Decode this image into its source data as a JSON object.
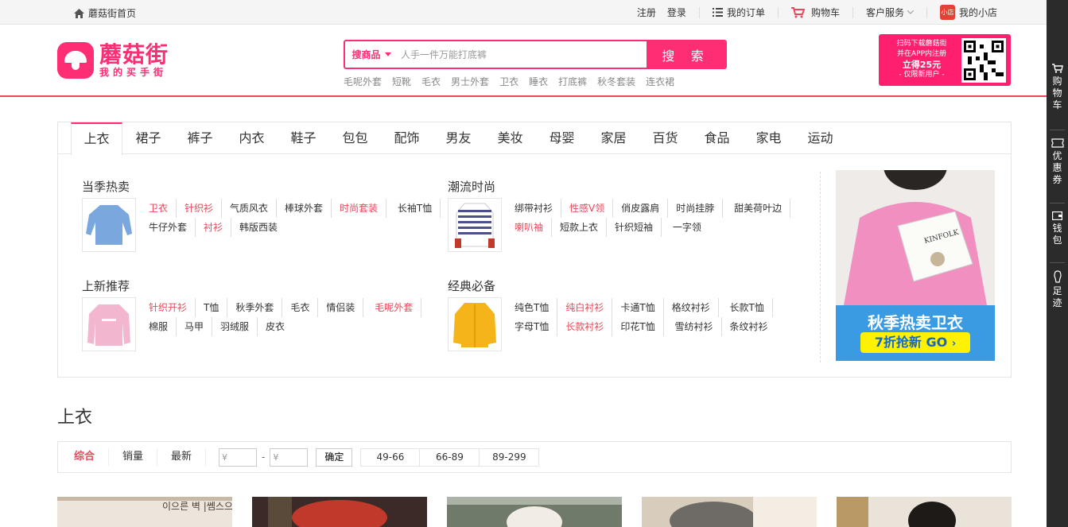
{
  "topbar": {
    "home": "蘑菇街首页",
    "register": "注册",
    "login": "登录",
    "orders": "我的订单",
    "cart": "购物车",
    "service": "客户服务",
    "shop_badge": "小店",
    "shop": "我的小店"
  },
  "logo": {
    "name": "蘑菇街",
    "slogan": "我的买手街"
  },
  "search": {
    "scope": "搜商品",
    "placeholder": "人手一件万能打底裤",
    "button": "搜 索",
    "hotwords": [
      "毛呢外套",
      "短靴",
      "毛衣",
      "男士外套",
      "卫衣",
      "睡衣",
      "打底裤",
      "秋冬套装",
      "连衣裙"
    ]
  },
  "promo": {
    "line1": "扫码下载蘑菇街",
    "line2": "并在APP内注册",
    "line3": "立得25元",
    "line4": "- 仅限新用户 -"
  },
  "sidebar": {
    "cart": "购物车",
    "coupon": "优惠券",
    "wallet": "钱包",
    "footprint": "足迹"
  },
  "tabs": [
    "上衣",
    "裙子",
    "裤子",
    "内衣",
    "鞋子",
    "包包",
    "配饰",
    "男友",
    "美妆",
    "母婴",
    "家居",
    "百货",
    "食品",
    "家电",
    "运动"
  ],
  "groups": [
    {
      "title": "当季热卖",
      "links": [
        {
          "t": "卫衣",
          "hot": true
        },
        {
          "t": "针织衫",
          "hot": true
        },
        {
          "t": "气质风衣",
          "hot": false
        },
        {
          "t": "棒球外套",
          "hot": false
        },
        {
          "t": "时尚套装",
          "hot": true
        },
        {
          "t": "长袖T恤",
          "hot": false
        },
        {
          "t": "牛仔外套",
          "hot": false
        },
        {
          "t": "衬衫",
          "hot": true
        },
        {
          "t": "韩版西装",
          "hot": false
        }
      ]
    },
    {
      "title": "潮流时尚",
      "links": [
        {
          "t": "绑带衬衫",
          "hot": false
        },
        {
          "t": "性感V领",
          "hot": true
        },
        {
          "t": "俏皮露肩",
          "hot": false
        },
        {
          "t": "时尚挂脖",
          "hot": false
        },
        {
          "t": "甜美荷叶边",
          "hot": false
        },
        {
          "t": "喇叭袖",
          "hot": true
        },
        {
          "t": "短款上衣",
          "hot": false
        },
        {
          "t": "针织短袖",
          "hot": false
        },
        {
          "t": "一字领",
          "hot": false
        }
      ]
    },
    {
      "title": "上新推荐",
      "links": [
        {
          "t": "针织开衫",
          "hot": true
        },
        {
          "t": "T恤",
          "hot": false
        },
        {
          "t": "秋季外套",
          "hot": false
        },
        {
          "t": "毛衣",
          "hot": false
        },
        {
          "t": "情侣装",
          "hot": false
        },
        {
          "t": "毛呢外套",
          "hot": true
        },
        {
          "t": "棉服",
          "hot": false
        },
        {
          "t": "马甲",
          "hot": false
        },
        {
          "t": "羽绒服",
          "hot": false
        },
        {
          "t": "皮衣",
          "hot": false
        }
      ]
    },
    {
      "title": "经典必备",
      "links": [
        {
          "t": "纯色T恤",
          "hot": false
        },
        {
          "t": "纯白衬衫",
          "hot": true
        },
        {
          "t": "卡通T恤",
          "hot": false
        },
        {
          "t": "格纹衬衫",
          "hot": false
        },
        {
          "t": "长款T恤",
          "hot": false
        },
        {
          "t": "字母T恤",
          "hot": false
        },
        {
          "t": "长款衬衫",
          "hot": true
        },
        {
          "t": "印花T恤",
          "hot": false
        },
        {
          "t": "雪纺衬衫",
          "hot": false
        },
        {
          "t": "条纹衬衫",
          "hot": false
        }
      ]
    }
  ],
  "banner": {
    "title": "秋季热卖卫衣",
    "cta": "7折抢新 GO",
    "magazine": "KINFOLK"
  },
  "section_title": "上衣",
  "filter": {
    "sorts": [
      "综合",
      "销量",
      "最新"
    ],
    "price_min_placeholder": "¥",
    "price_max_placeholder": "¥",
    "dash": "-",
    "confirm": "确定",
    "ranges": [
      "49-66",
      "66-89",
      "89-299"
    ]
  },
  "products_partial_text": "이으른 벽 |쎔스으",
  "colors": {
    "brand": "#ff2d74",
    "hot_link": "#e8485a",
    "sidebar": "#2b2b2b",
    "banner_blue": "#3a9be3",
    "cta_yellow": "#fff200"
  }
}
